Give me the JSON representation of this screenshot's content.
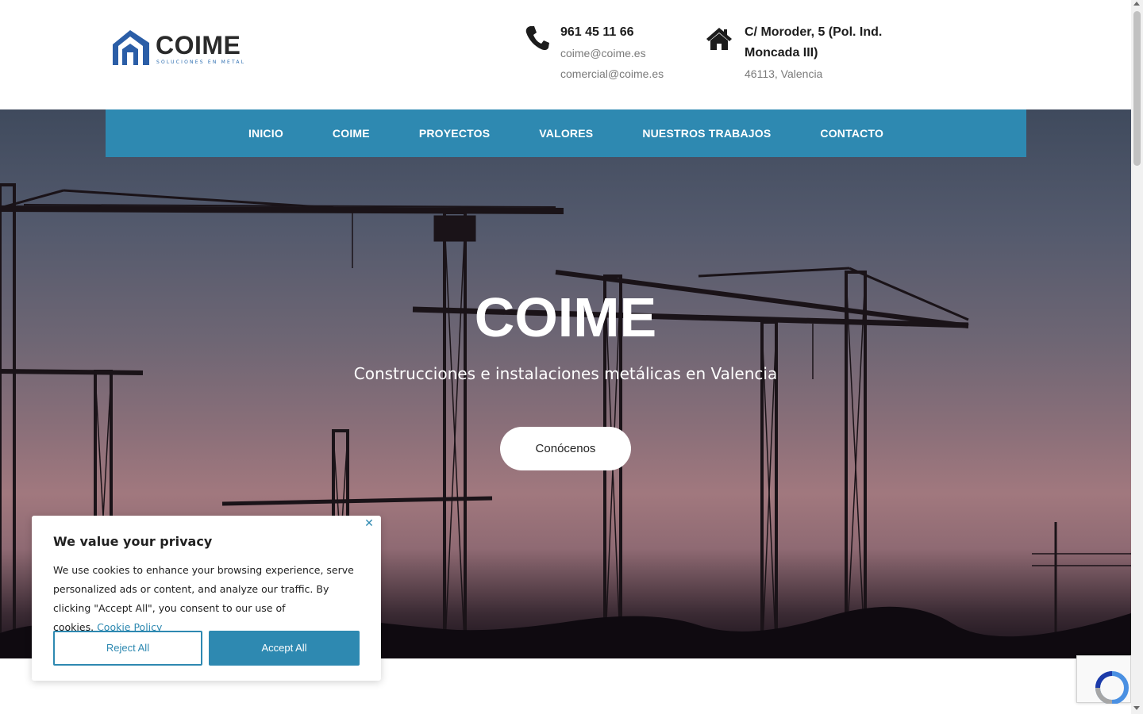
{
  "brand": {
    "name": "COIME",
    "tagline": "Soluciones en metal",
    "colors": {
      "accent": "#2e89b1",
      "logo_blue": "#2b5ea7",
      "text": "#1c1c1c"
    }
  },
  "contact": {
    "phone": "961 45 11 66",
    "email_1": "coime@coime.es",
    "email_2": "comercial@coime.es",
    "address_line_1": "C/ Moroder, 5 (Pol. Ind.",
    "address_line_2": "Moncada III)",
    "address_line_3": "46113, Valencia",
    "phone_icon": "phone-icon",
    "address_icon": "home-icon"
  },
  "nav": {
    "items": [
      {
        "label": "INICIO"
      },
      {
        "label": "COIME"
      },
      {
        "label": "PROYECTOS"
      },
      {
        "label": "VALORES"
      },
      {
        "label": "NUESTROS TRABAJOS"
      },
      {
        "label": "CONTACTO"
      }
    ]
  },
  "hero": {
    "title": "COIME",
    "subtitle": "Construcciones e instalaciones metálicas en Valencia",
    "cta_label": "Conócenos"
  },
  "cookie_banner": {
    "title": "We value your privacy",
    "text": "We use cookies to enhance your browsing experience, serve personalized ads or content, and analyze our traffic. By clicking \"Accept All\", you consent to our use of cookies.",
    "policy_link": "Cookie Policy",
    "reject_label": "Reject All",
    "accept_label": "Accept All",
    "close_icon": "close-icon"
  }
}
